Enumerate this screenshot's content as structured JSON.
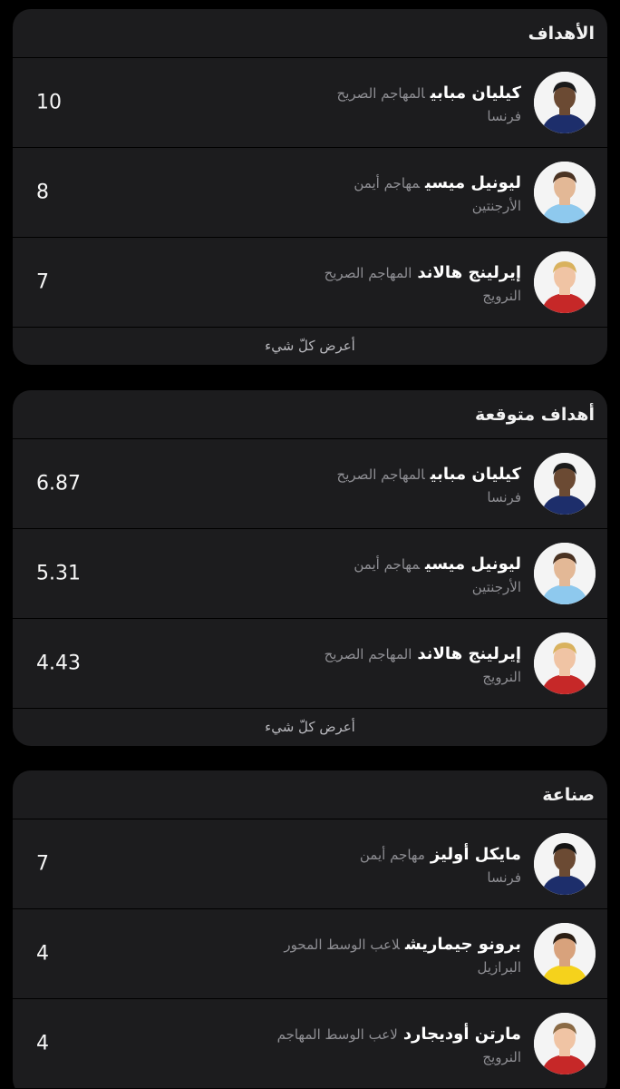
{
  "sections": [
    {
      "title": "الأهداف",
      "see_all": "أعرض كلّ شيء",
      "players": [
        {
          "name": "كيليان مبابي",
          "role": "المهاجم الصريح",
          "country": "فرنسا",
          "value": "10",
          "kit": "#1d2e6b",
          "skin": "#6b4a33",
          "hair": "#1a1a1a"
        },
        {
          "name": "ليونيل ميسي",
          "role": "مهاجم أيمن",
          "country": "الأرجنتين",
          "value": "8",
          "kit": "#8ec9ee",
          "skin": "#e3b896",
          "hair": "#4a3323"
        },
        {
          "name": "إيرلينج هالاند",
          "role": "المهاجم الصريح",
          "country": "النرويج",
          "value": "7",
          "kit": "#c62828",
          "skin": "#f0c4a4",
          "hair": "#d9b25e"
        }
      ]
    },
    {
      "title": "أهداف متوقعة",
      "see_all": "أعرض كلّ شيء",
      "players": [
        {
          "name": "كيليان مبابي",
          "role": "المهاجم الصريح",
          "country": "فرنسا",
          "value": "6.87",
          "kit": "#1d2e6b",
          "skin": "#6b4a33",
          "hair": "#1a1a1a"
        },
        {
          "name": "ليونيل ميسي",
          "role": "مهاجم أيمن",
          "country": "الأرجنتين",
          "value": "5.31",
          "kit": "#8ec9ee",
          "skin": "#e3b896",
          "hair": "#4a3323"
        },
        {
          "name": "إيرلينج هالاند",
          "role": "المهاجم الصريح",
          "country": "النرويج",
          "value": "4.43",
          "kit": "#c62828",
          "skin": "#f0c4a4",
          "hair": "#d9b25e"
        }
      ]
    },
    {
      "title": "صناعة",
      "players": [
        {
          "name": "مايكل أوليز",
          "role": "مهاجم أيمن",
          "country": "فرنسا",
          "value": "7",
          "kit": "#1d2e6b",
          "skin": "#6b4a33",
          "hair": "#141414"
        },
        {
          "name": "برونو جيماريش",
          "role": "لاعب الوسط المحور",
          "country": "البرازيل",
          "value": "4",
          "kit": "#f5d21c",
          "skin": "#d8a27c",
          "hair": "#2a1d14"
        },
        {
          "name": "مارتن أوديجارد",
          "role": "لاعب الوسط المهاجم",
          "country": "النرويج",
          "value": "4",
          "kit": "#c62828",
          "skin": "#f0c4a4",
          "hair": "#8a6a45"
        }
      ]
    }
  ]
}
